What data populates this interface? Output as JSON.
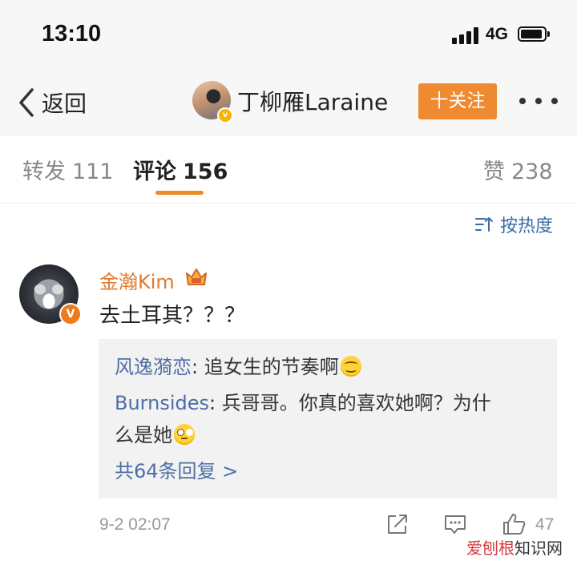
{
  "status_bar": {
    "time": "13:10",
    "network": "4G"
  },
  "nav": {
    "back_label": "返回",
    "user_name": "丁柳雁Laraine",
    "follow_label": "十关注"
  },
  "tabs": [
    {
      "label": "转发",
      "count": "111"
    },
    {
      "label": "评论",
      "count": "156"
    },
    {
      "label": "赞",
      "count": "238"
    }
  ],
  "sort_label": "按热度",
  "comment": {
    "user": "金瀚Kim",
    "text": "去土耳其？？？",
    "replies": [
      {
        "user": "风逸漪恋",
        "text": "追女生的节奏啊"
      },
      {
        "user": "Burnsides",
        "text": "兵哥哥。你真的喜欢她啊？为什",
        "text2": "么是她"
      }
    ],
    "more_replies": "共64条回复 >",
    "date": "9-2 02:07",
    "like_count": "47"
  },
  "watermark": {
    "part1": "爱",
    "part2": "刨根",
    "part3": "知识网"
  },
  "colors": {
    "accent_orange": "#ef8a30",
    "link_blue": "#4d6fa5",
    "username_orange": "#e07a2e"
  }
}
